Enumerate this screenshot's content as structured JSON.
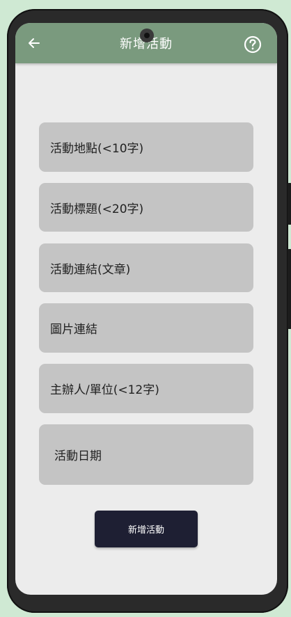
{
  "appbar": {
    "title": "新增活動",
    "back_icon": "arrow-left-icon",
    "help_icon": "help-circle-icon"
  },
  "form": {
    "fields": [
      {
        "placeholder": "活動地點(<10字)"
      },
      {
        "placeholder": "活動標題(<20字)"
      },
      {
        "placeholder": "活動連結(文章)"
      },
      {
        "placeholder": "圖片連結"
      },
      {
        "placeholder": "主辦人/單位(<12字)"
      },
      {
        "placeholder": "活動日期"
      }
    ],
    "submit_label": "新增活動"
  },
  "colors": {
    "appbar": "#7a9a7e",
    "field_bg": "#c4c4c4",
    "button_bg": "#1e1f33",
    "screen_bg": "#ececec"
  }
}
